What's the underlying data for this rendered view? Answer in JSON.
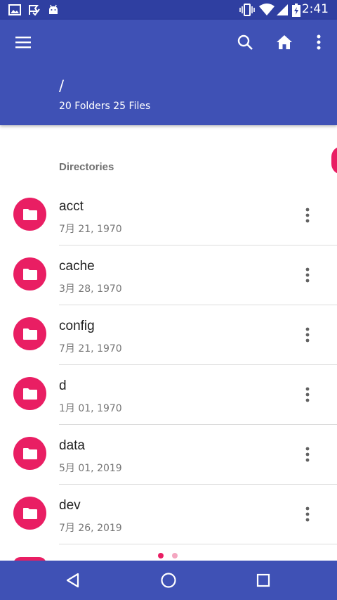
{
  "status_bar": {
    "time": "2:41",
    "icons": [
      "image-icon",
      "check-flag-icon",
      "android-icon",
      "vibrate-icon",
      "wifi-icon",
      "signal-icon",
      "battery-charging-icon"
    ]
  },
  "app_bar": {
    "path": "/",
    "summary": "20 Folders 25 Files",
    "actions": [
      "menu-icon",
      "search-icon",
      "home-icon",
      "more-vert-icon"
    ]
  },
  "section": {
    "title": "Directories"
  },
  "directories": [
    {
      "name": "acct",
      "date": "7月 21, 1970"
    },
    {
      "name": "cache",
      "date": "3月 28, 1970"
    },
    {
      "name": "config",
      "date": "7月 21, 1970"
    },
    {
      "name": "d",
      "date": "1月 01, 1970"
    },
    {
      "name": "data",
      "date": "5月 01, 2019"
    },
    {
      "name": "dev",
      "date": "7月 26, 2019"
    }
  ],
  "pager": {
    "pages": 2,
    "current": 1
  },
  "colors": {
    "primary": "#3f51b5",
    "primary_dark": "#2f3fa1",
    "accent": "#e91e63",
    "dot_active": "#e91e63",
    "dot_inactive": "#f4a6c0"
  },
  "nav_bar": {
    "buttons": [
      "back-icon",
      "home-circle-icon",
      "recents-icon"
    ]
  }
}
